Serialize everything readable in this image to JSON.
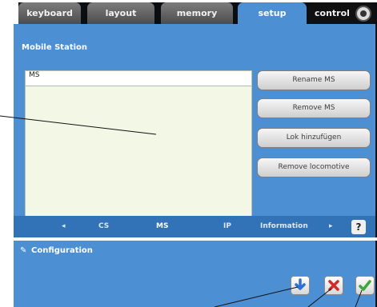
{
  "tabs": [
    {
      "label": "keyboard",
      "active": false
    },
    {
      "label": "layout",
      "active": false
    },
    {
      "label": "memory",
      "active": false
    },
    {
      "label": "setup",
      "active": true
    },
    {
      "label": "control",
      "active": false
    }
  ],
  "panel": {
    "title": "Mobile Station"
  },
  "list": {
    "items": [
      "MS"
    ]
  },
  "buttons": {
    "rename": "Rename MS",
    "remove": "Remove MS",
    "add_loco": "Lok hinzufügen",
    "remove_loco": "Remove locomotive"
  },
  "nav": {
    "prev": "◂",
    "items": [
      "CS",
      "MS",
      "IP",
      "Information"
    ],
    "next": "▸",
    "active": "MS",
    "help": "?"
  },
  "config": {
    "title": "Configuration"
  },
  "colors": {
    "panel": "#4d8fd3",
    "nav_strip": "#3272b6",
    "download_icon": "#2f6fd6",
    "cancel_icon": "#d42a2a",
    "confirm_icon": "#3aa83a"
  }
}
